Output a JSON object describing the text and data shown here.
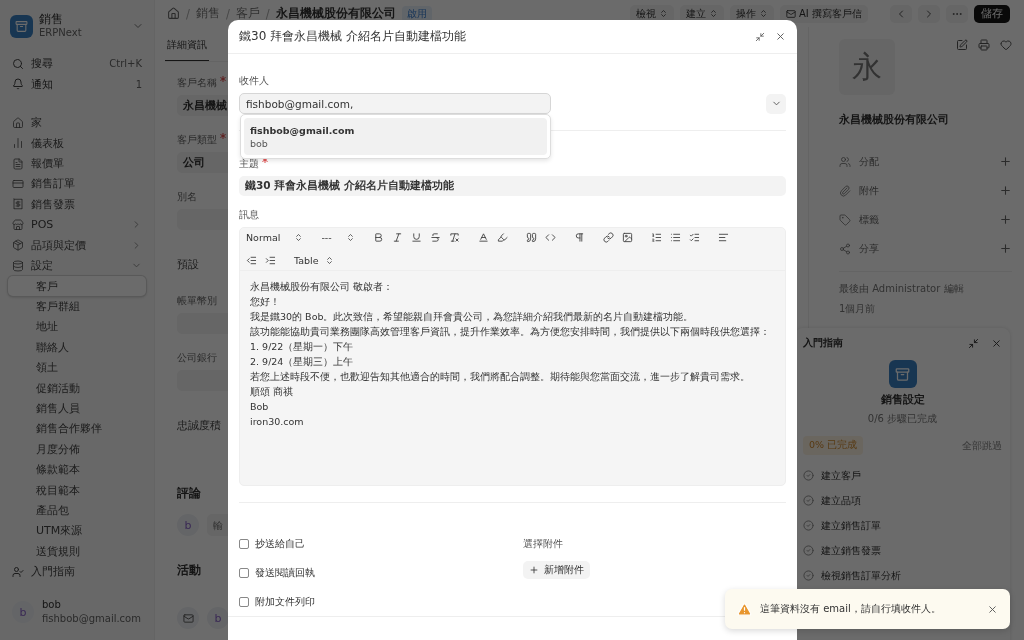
{
  "sidebar": {
    "app": {
      "title": "銷售",
      "subtitle": "ERPNext"
    },
    "search": {
      "label": "搜尋",
      "shortcut": "Ctrl+K"
    },
    "notifications": {
      "label": "通知",
      "count": "1"
    },
    "items": [
      {
        "label": "家",
        "selected": false
      },
      {
        "label": "儀表板",
        "selected": false
      },
      {
        "label": "報價單",
        "selected": false
      },
      {
        "label": "銷售訂單",
        "selected": false
      },
      {
        "label": "銷售發票",
        "selected": false
      },
      {
        "label": "POS",
        "selected": false,
        "expanded": false
      },
      {
        "label": "品項與定價",
        "selected": false,
        "expanded": false
      },
      {
        "label": "設定",
        "selected": false,
        "expanded": true,
        "children": [
          {
            "label": "客戶",
            "selected": true
          },
          {
            "label": "客戶群組",
            "selected": false
          },
          {
            "label": "地址",
            "selected": false
          },
          {
            "label": "聯絡人",
            "selected": false
          },
          {
            "label": "領土",
            "selected": false
          },
          {
            "label": "促銷活動",
            "selected": false
          },
          {
            "label": "銷售人員",
            "selected": false
          },
          {
            "label": "銷售合作夥伴",
            "selected": false
          },
          {
            "label": "月度分佈",
            "selected": false
          },
          {
            "label": "條款範本",
            "selected": false
          },
          {
            "label": "稅目範本",
            "selected": false
          },
          {
            "label": "產品包",
            "selected": false
          },
          {
            "label": "UTM來源",
            "selected": false
          },
          {
            "label": "送貨規則",
            "selected": false
          }
        ]
      }
    ],
    "onboarding": "入門指南",
    "user": {
      "avatar": "b",
      "name": "bob",
      "email": "fishbob@gmail.com"
    }
  },
  "topbar": {
    "separator": "/",
    "breadcrumbs": [
      "銷售",
      "客戶",
      "永昌機械股份有限公司"
    ],
    "status": "啟用",
    "menus": [
      "檢視",
      "建立",
      "操作"
    ],
    "ai_button": "AI 撰寫客戶信",
    "save": "儲存"
  },
  "form": {
    "tabs": [
      {
        "label": "詳細資訊",
        "selected": true
      }
    ],
    "items": [
      {
        "kind": "field",
        "label": "客戶名稱",
        "required": true,
        "value": "永昌機械"
      },
      {
        "kind": "field",
        "label": "客戶類型",
        "required": true,
        "value": "公司"
      },
      {
        "kind": "field",
        "label": "別名",
        "required": false
      },
      {
        "kind": "section",
        "label": "預設"
      },
      {
        "kind": "field",
        "label": "帳單幣別",
        "required": false
      },
      {
        "kind": "field",
        "label": "公司銀行",
        "required": false
      },
      {
        "kind": "section",
        "label": "忠誠度積"
      }
    ],
    "comments": {
      "title": "評論",
      "avatar": "b",
      "placeholder": "輸"
    },
    "activity": {
      "title": "活動",
      "avatar": "b"
    }
  },
  "record": {
    "avatar": "永",
    "name": "永昌機械股份有限公司",
    "actions": [
      {
        "label": "分配"
      },
      {
        "label": "附件"
      },
      {
        "label": "標籤"
      },
      {
        "label": "分享"
      }
    ],
    "modified_by": "最後由 Administrator 編輯",
    "modified_at": "1個月前"
  },
  "guide": {
    "title": "入門指南",
    "module": "銷售設定",
    "progress": "0/6 步驟已完成",
    "percent": "0% 已完成",
    "skip": "全部跳過",
    "steps": [
      {
        "label": "建立客戶",
        "done": false
      },
      {
        "label": "建立品項",
        "done": false
      },
      {
        "label": "建立銷售訂單",
        "done": false
      },
      {
        "label": "建立銷售發票",
        "done": false
      },
      {
        "label": "檢視銷售訂單分析",
        "done": false
      }
    ]
  },
  "dialog": {
    "title": "鐵30 拜會永昌機械 介紹名片自動建檔功能",
    "recipients": {
      "label": "收件人",
      "value": "fishbob@gmail.com,"
    },
    "suggestion": {
      "email": "fishbob@gmail.com",
      "name": "bob"
    },
    "subject": {
      "label": "主題",
      "required": true,
      "value": "鐵30 拜會永昌機械 介紹名片自動建檔功能"
    },
    "message": {
      "label": "訊息",
      "style": "Normal",
      "size": "---",
      "table": "Table",
      "lines": [
        "永昌機械股份有限公司 敬啟者：",
        "您好！",
        "我是鐵30的 Bob。此次致信，希望能親自拜會貴公司，為您詳細介紹我們最新的名片自動建檔功能。",
        "該功能能協助貴司業務團隊高效管理客戶資訊，提升作業效率。為方便您安排時間，我們提供以下兩個時段供您選擇：",
        "1. 9/22（星期一）下午",
        "2. 9/24（星期三）上午",
        "若您上述時段不便，也歡迎告知其他適合的時間，我們將配合調整。期待能與您當面交流，進一步了解貴司需求。",
        "順頌 商祺",
        "Bob",
        "iron30.com"
      ]
    },
    "options": [
      {
        "label": "抄送給自己",
        "checked": false
      },
      {
        "label": "發送閱讀回執",
        "checked": false
      },
      {
        "label": "附加文件列印",
        "checked": false
      }
    ],
    "attachments": {
      "label": "選擇附件",
      "button": "新增附件"
    }
  },
  "toast": {
    "kind": "warning",
    "text": "這筆資料沒有 email，請自行填收件人。"
  }
}
